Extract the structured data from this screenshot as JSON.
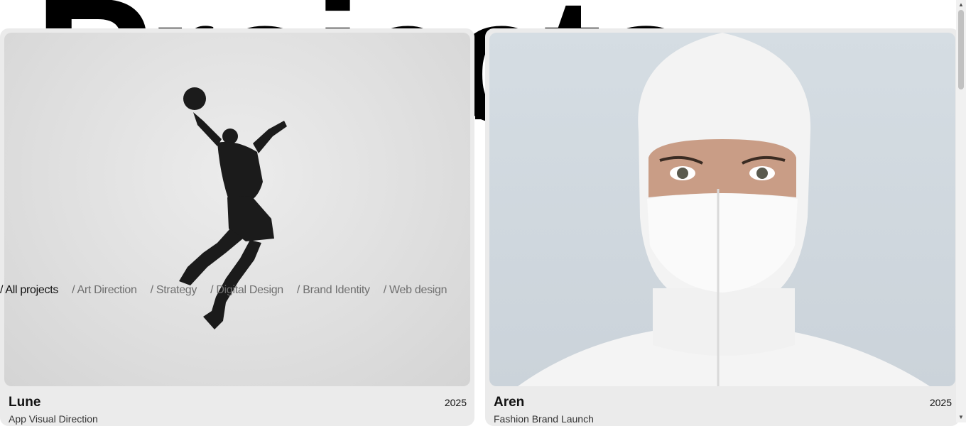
{
  "hero": {
    "title": "Projects"
  },
  "filters": [
    {
      "label": "/ All projects",
      "active": true
    },
    {
      "label": "/ Art Direction",
      "active": false
    },
    {
      "label": "/ Strategy",
      "active": false
    },
    {
      "label": "/ Digital Design",
      "active": false
    },
    {
      "label": "/ Brand Identity",
      "active": false
    },
    {
      "label": "/ Web design",
      "active": false
    }
  ],
  "projects": [
    {
      "title": "Lune",
      "year": "2025",
      "subtitle": "App Visual Direction",
      "image": "basketball-player-silhouette"
    },
    {
      "title": "Aren",
      "year": "2025",
      "subtitle": "Fashion Brand Launch",
      "image": "white-balaclava-portrait"
    }
  ],
  "scrollbar": {
    "up_arrow": "▲",
    "down_arrow": "▼"
  }
}
